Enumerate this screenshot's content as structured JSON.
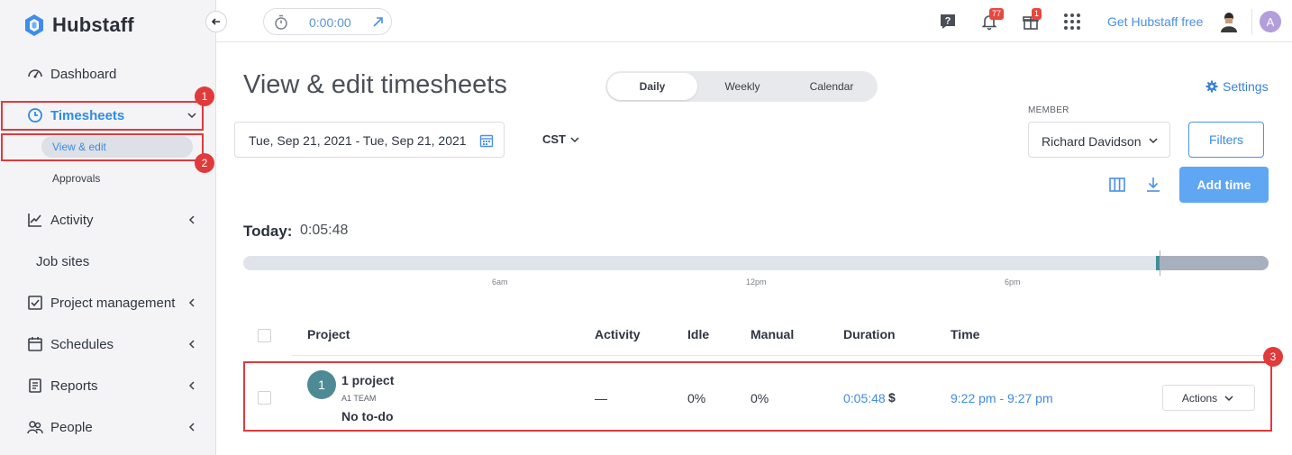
{
  "app": {
    "name": "Hubstaff"
  },
  "sidebar": {
    "items": [
      {
        "label": "Dashboard"
      },
      {
        "label": "Timesheets"
      },
      {
        "label": "Activity"
      },
      {
        "label": "Job sites"
      },
      {
        "label": "Project management"
      },
      {
        "label": "Schedules"
      },
      {
        "label": "Reports"
      },
      {
        "label": "People"
      }
    ],
    "timesheets_sub": [
      {
        "label": "View & edit"
      },
      {
        "label": "Approvals"
      }
    ]
  },
  "annotations": {
    "marker1": "1",
    "marker2": "2",
    "marker3": "3"
  },
  "topbar": {
    "timer_value": "0:00:00",
    "notifications_count": "77",
    "gifts_count": "1",
    "get_free_label": "Get Hubstaff free",
    "user_initial": "A"
  },
  "page": {
    "title": "View & edit timesheets",
    "view_tabs": [
      "Daily",
      "Weekly",
      "Calendar"
    ],
    "selected_tab": "Daily",
    "settings_label": "Settings",
    "date_range": "Tue, Sep 21, 2021 - Tue, Sep 21, 2021",
    "timezone": "CST",
    "member_label": "MEMBER",
    "member_value": "Richard Davidson",
    "filters_label": "Filters",
    "add_time_label": "Add time",
    "today_label": "Today:",
    "today_value": "0:05:48",
    "timeline_ticks": [
      "6am",
      "12pm",
      "6pm"
    ]
  },
  "table": {
    "headers": [
      "Project",
      "Activity",
      "Idle",
      "Manual",
      "Duration",
      "Time"
    ],
    "rows": [
      {
        "avatar": "1",
        "project": "1 project",
        "team": "A1 TEAM",
        "todo": "No to-do",
        "activity": "—",
        "idle": "0%",
        "manual": "0%",
        "duration": "0:05:48",
        "billable_symbol": "$",
        "time": "9:22 pm - 9:27 pm",
        "actions_label": "Actions"
      }
    ]
  },
  "colors": {
    "accent": "#2f8be6",
    "highlight": "#e0393e",
    "button": "#5fa6f3"
  }
}
